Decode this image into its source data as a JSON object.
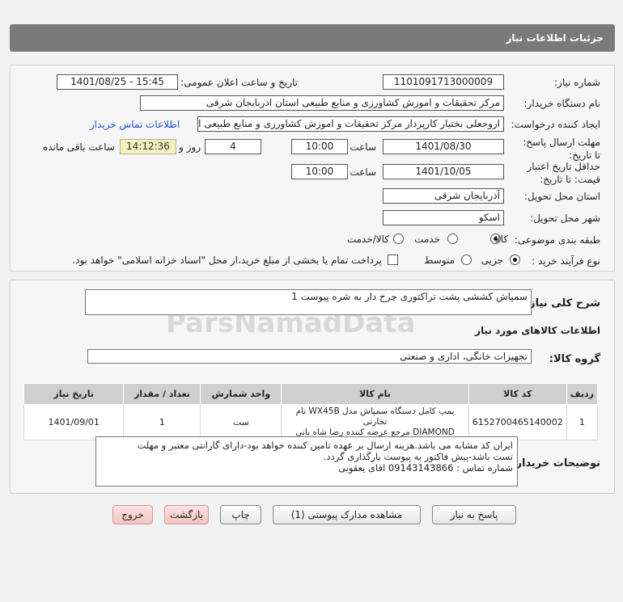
{
  "page_title": "جزئیات اطلاعات نیاز",
  "fields": {
    "need_number_label": "شماره نیاز:",
    "need_number": "1101091713000009",
    "announce_label": "تاریخ و ساعت اعلان عمومی:",
    "announce_value": "1401/08/25 - 15:45",
    "buyer_org_label": "نام دستگاه خریدار:",
    "buyer_org": "مرکز تحقیقات و اموزش کشاورزی و منابع طبیعی استان اذربایجان شرقی",
    "creator_label": "ایجاد کننده درخواست:",
    "creator": "اروجعلی بختیار کارپرداز مرکز تحقیقات و اموزش کشاورزی و منابع طبیعی استان ا",
    "contact_link": "اطلاعات تماس خریدار",
    "deadline_label": "مهلت ارسال پاسخ: تا تاریخ:",
    "deadline_date": "1401/08/30",
    "time_label": "ساعت",
    "deadline_time": "10:00",
    "days_count": "4",
    "days_label": "روز و",
    "remaining_time": "14:12:36",
    "remaining_label": "ساعت باقی مانده",
    "validity_label": "حداقل تاریخ اعتبار قیمت: تا تاریخ:",
    "validity_date": "1401/10/05",
    "validity_time": "10:00",
    "province_label": "استان محل تحویل:",
    "province": "آذربایجان شرقی",
    "city_label": "شهر محل تحویل:",
    "city": "اسکو",
    "category_label": "طبقه بندی موضوعی:",
    "category_options": [
      "کالا",
      "خدمت",
      "کالا/خدمت"
    ],
    "process_label": "نوع فرآیند خرید :",
    "process_options": [
      "جزیی",
      "متوسط"
    ],
    "payment_note": "پرداخت تمام یا بخشی از مبلغ خرید،از محل \"اسناد خزانه اسلامی\" خواهد بود."
  },
  "description": {
    "label": "شرح کلی نیاز:",
    "value": "سمپاش کششی پشت تراکتوری چرخ دار به شره پیوست 1"
  },
  "goods_section_title": "اطلاعات کالاهای مورد نیاز",
  "goods_group": {
    "label": "گروه کالا:",
    "value": "تجهیزات خانگی، اداری و صنعتی"
  },
  "table": {
    "headers": [
      "ردیف",
      "کد کالا",
      "نام کالا",
      "واحد شمارش",
      "تعداد / مقدار",
      "تاریخ نیاز"
    ],
    "rows": [
      {
        "row": "1",
        "code": "6152700465140002",
        "name_line1": "پمپ کامل دستگاه سمپاش مدل WX45B نام تجارتی",
        "name_line2": "DIAMOND مرجع عرضه کننده رضا شاه بانی",
        "unit": "ست",
        "qty": "1",
        "date": "1401/09/01"
      }
    ]
  },
  "buyer_notes": {
    "label": "توضیحات خریدار:",
    "line1": "ایران کد مشابه می باشد.هزینه ارسال بر عهده تامین کننده خواهد بود-دارای گارانتی معتبر و مهلت",
    "line2": "تست باشد-پیش فاکتور به پیوست بارگذاری گردد.",
    "line3": "شماره تماس : 09143143866 اقای یعقوبی"
  },
  "buttons": {
    "reply": "پاسخ به نیاز",
    "view_docs": "مشاهده مدارک پیوستی (1)",
    "print": "چاپ",
    "back": "بازگشت",
    "exit": "خروج"
  }
}
